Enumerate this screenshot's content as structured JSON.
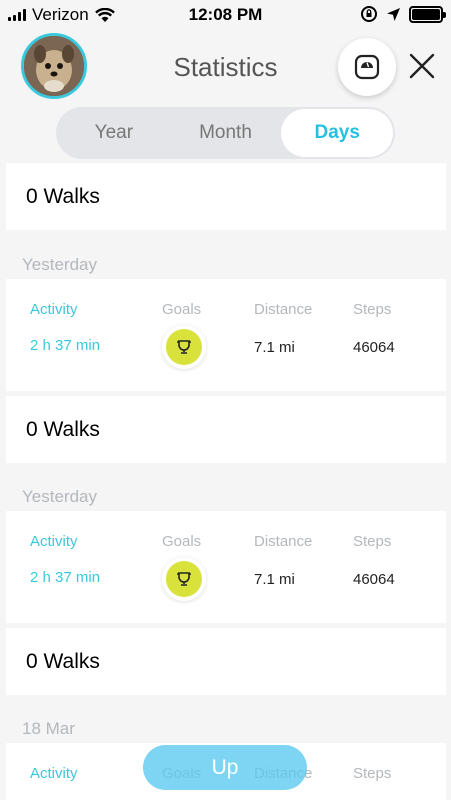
{
  "status_bar": {
    "carrier": "Verizon",
    "time": "12:08 PM"
  },
  "header": {
    "title": "Statistics"
  },
  "tabs": [
    {
      "label": "Year",
      "active": false
    },
    {
      "label": "Month",
      "active": false
    },
    {
      "label": "Days",
      "active": true
    }
  ],
  "columns": {
    "activity": "Activity",
    "goals": "Goals",
    "distance": "Distance",
    "steps": "Steps"
  },
  "sections": [
    {
      "walks": "0 Walks",
      "date": "Yesterday",
      "activity": "2 h 37 min",
      "distance": "7.1 mi",
      "steps": "46064"
    },
    {
      "walks": "0 Walks",
      "date": "Yesterday",
      "activity": "2 h 37 min",
      "distance": "7.1 mi",
      "steps": "46064"
    },
    {
      "walks": "0 Walks",
      "date": "18 Mar"
    }
  ],
  "up_button": "Up",
  "colors": {
    "accent": "#26c0e0",
    "trophy": "#d8e23a"
  },
  "icons": [
    "signal-icon",
    "wifi-icon",
    "orientation-lock-icon",
    "location-arrow-icon",
    "battery-icon",
    "scale-icon",
    "close-icon",
    "trophy-icon"
  ]
}
